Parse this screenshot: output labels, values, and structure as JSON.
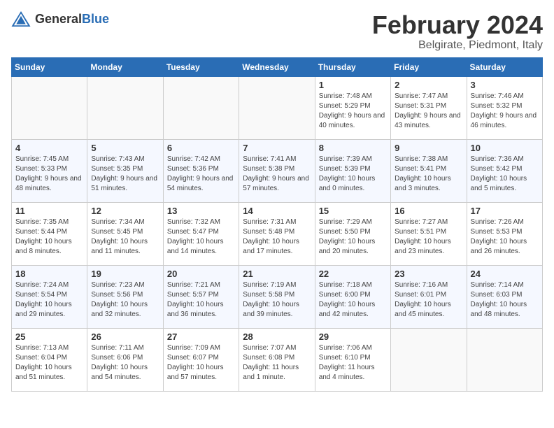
{
  "logo": {
    "text_general": "General",
    "text_blue": "Blue"
  },
  "title": {
    "month": "February 2024",
    "location": "Belgirate, Piedmont, Italy"
  },
  "days_of_week": [
    "Sunday",
    "Monday",
    "Tuesday",
    "Wednesday",
    "Thursday",
    "Friday",
    "Saturday"
  ],
  "weeks": [
    [
      {
        "day": "",
        "empty": true
      },
      {
        "day": "",
        "empty": true
      },
      {
        "day": "",
        "empty": true
      },
      {
        "day": "",
        "empty": true
      },
      {
        "day": "1",
        "sunrise": "Sunrise: 7:48 AM",
        "sunset": "Sunset: 5:29 PM",
        "daylight": "Daylight: 9 hours and 40 minutes."
      },
      {
        "day": "2",
        "sunrise": "Sunrise: 7:47 AM",
        "sunset": "Sunset: 5:31 PM",
        "daylight": "Daylight: 9 hours and 43 minutes."
      },
      {
        "day": "3",
        "sunrise": "Sunrise: 7:46 AM",
        "sunset": "Sunset: 5:32 PM",
        "daylight": "Daylight: 9 hours and 46 minutes."
      }
    ],
    [
      {
        "day": "4",
        "sunrise": "Sunrise: 7:45 AM",
        "sunset": "Sunset: 5:33 PM",
        "daylight": "Daylight: 9 hours and 48 minutes."
      },
      {
        "day": "5",
        "sunrise": "Sunrise: 7:43 AM",
        "sunset": "Sunset: 5:35 PM",
        "daylight": "Daylight: 9 hours and 51 minutes."
      },
      {
        "day": "6",
        "sunrise": "Sunrise: 7:42 AM",
        "sunset": "Sunset: 5:36 PM",
        "daylight": "Daylight: 9 hours and 54 minutes."
      },
      {
        "day": "7",
        "sunrise": "Sunrise: 7:41 AM",
        "sunset": "Sunset: 5:38 PM",
        "daylight": "Daylight: 9 hours and 57 minutes."
      },
      {
        "day": "8",
        "sunrise": "Sunrise: 7:39 AM",
        "sunset": "Sunset: 5:39 PM",
        "daylight": "Daylight: 10 hours and 0 minutes."
      },
      {
        "day": "9",
        "sunrise": "Sunrise: 7:38 AM",
        "sunset": "Sunset: 5:41 PM",
        "daylight": "Daylight: 10 hours and 3 minutes."
      },
      {
        "day": "10",
        "sunrise": "Sunrise: 7:36 AM",
        "sunset": "Sunset: 5:42 PM",
        "daylight": "Daylight: 10 hours and 5 minutes."
      }
    ],
    [
      {
        "day": "11",
        "sunrise": "Sunrise: 7:35 AM",
        "sunset": "Sunset: 5:44 PM",
        "daylight": "Daylight: 10 hours and 8 minutes."
      },
      {
        "day": "12",
        "sunrise": "Sunrise: 7:34 AM",
        "sunset": "Sunset: 5:45 PM",
        "daylight": "Daylight: 10 hours and 11 minutes."
      },
      {
        "day": "13",
        "sunrise": "Sunrise: 7:32 AM",
        "sunset": "Sunset: 5:47 PM",
        "daylight": "Daylight: 10 hours and 14 minutes."
      },
      {
        "day": "14",
        "sunrise": "Sunrise: 7:31 AM",
        "sunset": "Sunset: 5:48 PM",
        "daylight": "Daylight: 10 hours and 17 minutes."
      },
      {
        "day": "15",
        "sunrise": "Sunrise: 7:29 AM",
        "sunset": "Sunset: 5:50 PM",
        "daylight": "Daylight: 10 hours and 20 minutes."
      },
      {
        "day": "16",
        "sunrise": "Sunrise: 7:27 AM",
        "sunset": "Sunset: 5:51 PM",
        "daylight": "Daylight: 10 hours and 23 minutes."
      },
      {
        "day": "17",
        "sunrise": "Sunrise: 7:26 AM",
        "sunset": "Sunset: 5:53 PM",
        "daylight": "Daylight: 10 hours and 26 minutes."
      }
    ],
    [
      {
        "day": "18",
        "sunrise": "Sunrise: 7:24 AM",
        "sunset": "Sunset: 5:54 PM",
        "daylight": "Daylight: 10 hours and 29 minutes."
      },
      {
        "day": "19",
        "sunrise": "Sunrise: 7:23 AM",
        "sunset": "Sunset: 5:56 PM",
        "daylight": "Daylight: 10 hours and 32 minutes."
      },
      {
        "day": "20",
        "sunrise": "Sunrise: 7:21 AM",
        "sunset": "Sunset: 5:57 PM",
        "daylight": "Daylight: 10 hours and 36 minutes."
      },
      {
        "day": "21",
        "sunrise": "Sunrise: 7:19 AM",
        "sunset": "Sunset: 5:58 PM",
        "daylight": "Daylight: 10 hours and 39 minutes."
      },
      {
        "day": "22",
        "sunrise": "Sunrise: 7:18 AM",
        "sunset": "Sunset: 6:00 PM",
        "daylight": "Daylight: 10 hours and 42 minutes."
      },
      {
        "day": "23",
        "sunrise": "Sunrise: 7:16 AM",
        "sunset": "Sunset: 6:01 PM",
        "daylight": "Daylight: 10 hours and 45 minutes."
      },
      {
        "day": "24",
        "sunrise": "Sunrise: 7:14 AM",
        "sunset": "Sunset: 6:03 PM",
        "daylight": "Daylight: 10 hours and 48 minutes."
      }
    ],
    [
      {
        "day": "25",
        "sunrise": "Sunrise: 7:13 AM",
        "sunset": "Sunset: 6:04 PM",
        "daylight": "Daylight: 10 hours and 51 minutes."
      },
      {
        "day": "26",
        "sunrise": "Sunrise: 7:11 AM",
        "sunset": "Sunset: 6:06 PM",
        "daylight": "Daylight: 10 hours and 54 minutes."
      },
      {
        "day": "27",
        "sunrise": "Sunrise: 7:09 AM",
        "sunset": "Sunset: 6:07 PM",
        "daylight": "Daylight: 10 hours and 57 minutes."
      },
      {
        "day": "28",
        "sunrise": "Sunrise: 7:07 AM",
        "sunset": "Sunset: 6:08 PM",
        "daylight": "Daylight: 11 hours and 1 minute."
      },
      {
        "day": "29",
        "sunrise": "Sunrise: 7:06 AM",
        "sunset": "Sunset: 6:10 PM",
        "daylight": "Daylight: 11 hours and 4 minutes."
      },
      {
        "day": "",
        "empty": true
      },
      {
        "day": "",
        "empty": true
      }
    ]
  ]
}
